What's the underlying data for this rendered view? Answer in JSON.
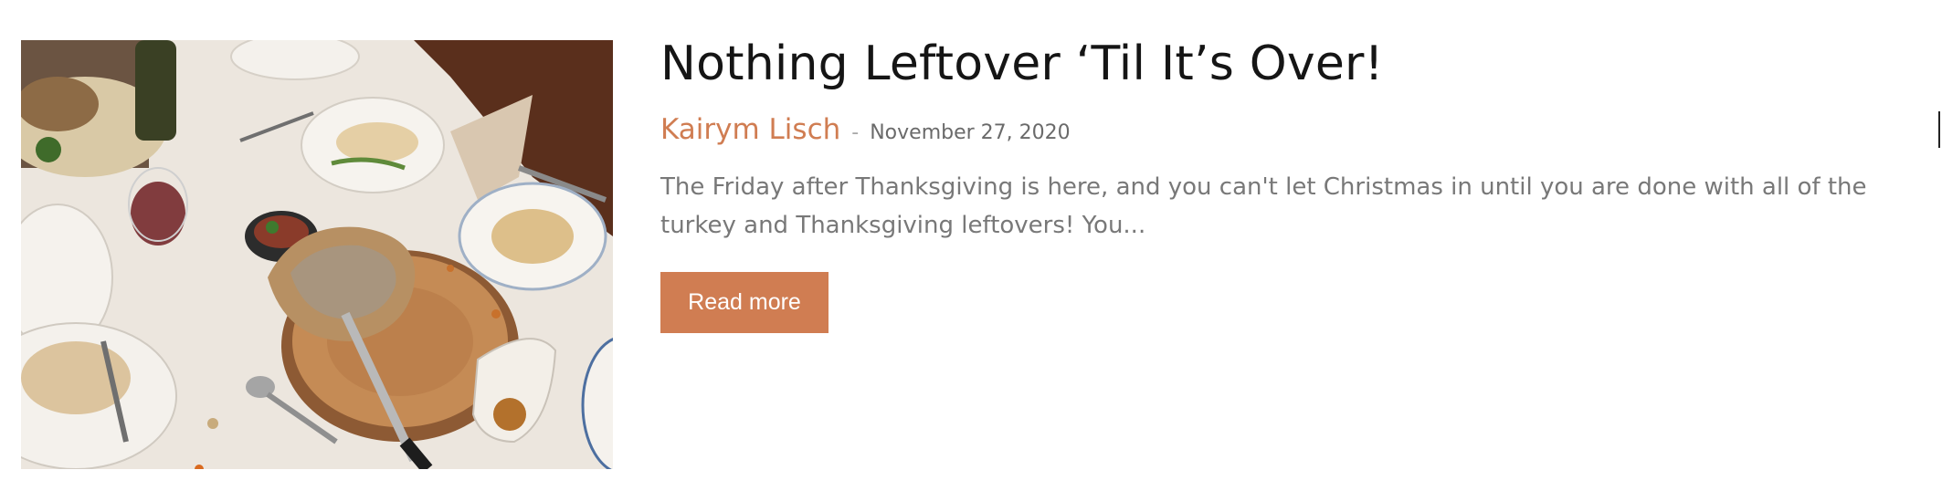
{
  "post": {
    "title": "Nothing Leftover ‘Til It’s Over!",
    "author": "Kairym Lisch",
    "separator": "-",
    "date": "November 27, 2020",
    "excerpt": "The Friday after Thanksgiving is here, and you can't let Christmas in until you are done with all of the turkey and Thanksgiving leftovers! You...",
    "read_more_label": "Read more",
    "thumbnail_alt": "Thanksgiving leftovers on a table"
  },
  "colors": {
    "accent": "#d07d52",
    "title": "#151515",
    "excerpt": "#787878",
    "date": "#6a6a6a"
  }
}
